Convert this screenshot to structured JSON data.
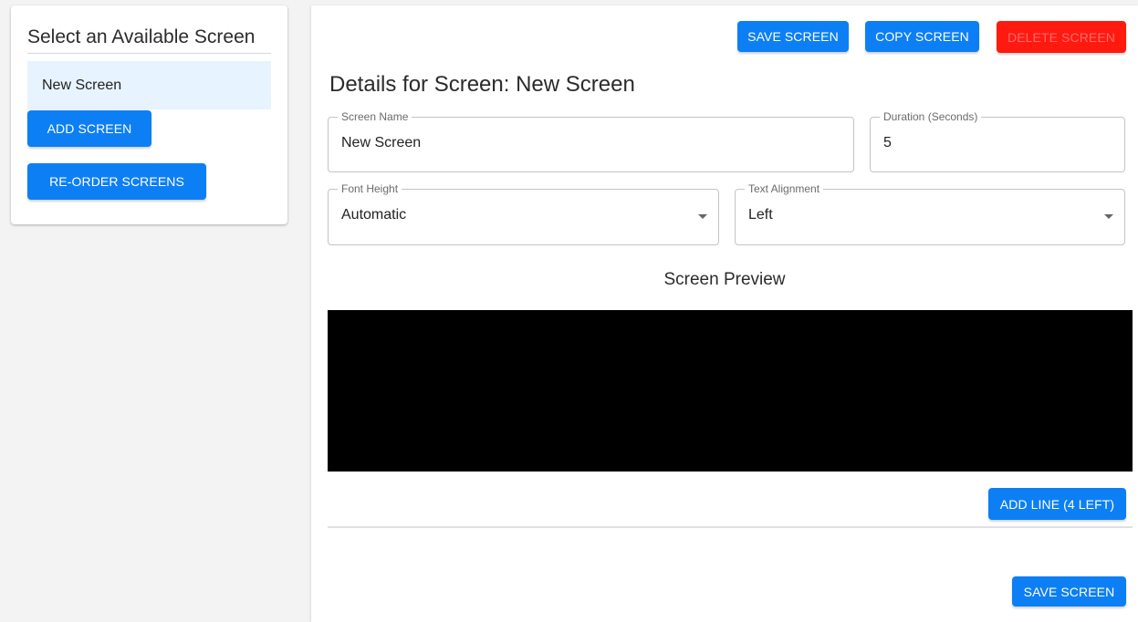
{
  "sidebar": {
    "title": "Select an Available Screen",
    "screens": [
      {
        "label": "New Screen"
      }
    ],
    "add_button": "ADD SCREEN",
    "reorder_button": "RE-ORDER SCREENS"
  },
  "toolbar": {
    "save_label": "SAVE SCREEN",
    "copy_label": "COPY SCREEN",
    "delete_label": "DELETE SCREEN"
  },
  "details": {
    "heading": "Details for Screen: New Screen",
    "screen_name": {
      "label": "Screen Name",
      "value": "New Screen"
    },
    "duration": {
      "label": "Duration (Seconds)",
      "value": "5"
    },
    "font_height": {
      "label": "Font Height",
      "value": "Automatic"
    },
    "text_alignment": {
      "label": "Text Alignment",
      "value": "Left"
    }
  },
  "preview": {
    "title": "Screen Preview",
    "add_line_label": "ADD LINE (4 LEFT)"
  },
  "footer": {
    "save_label": "SAVE SCREEN"
  },
  "colors": {
    "primary": "#0d7ff5",
    "danger": "#ff1a10",
    "selected_item": "#e7f3ff",
    "preview_background": "#000000"
  }
}
